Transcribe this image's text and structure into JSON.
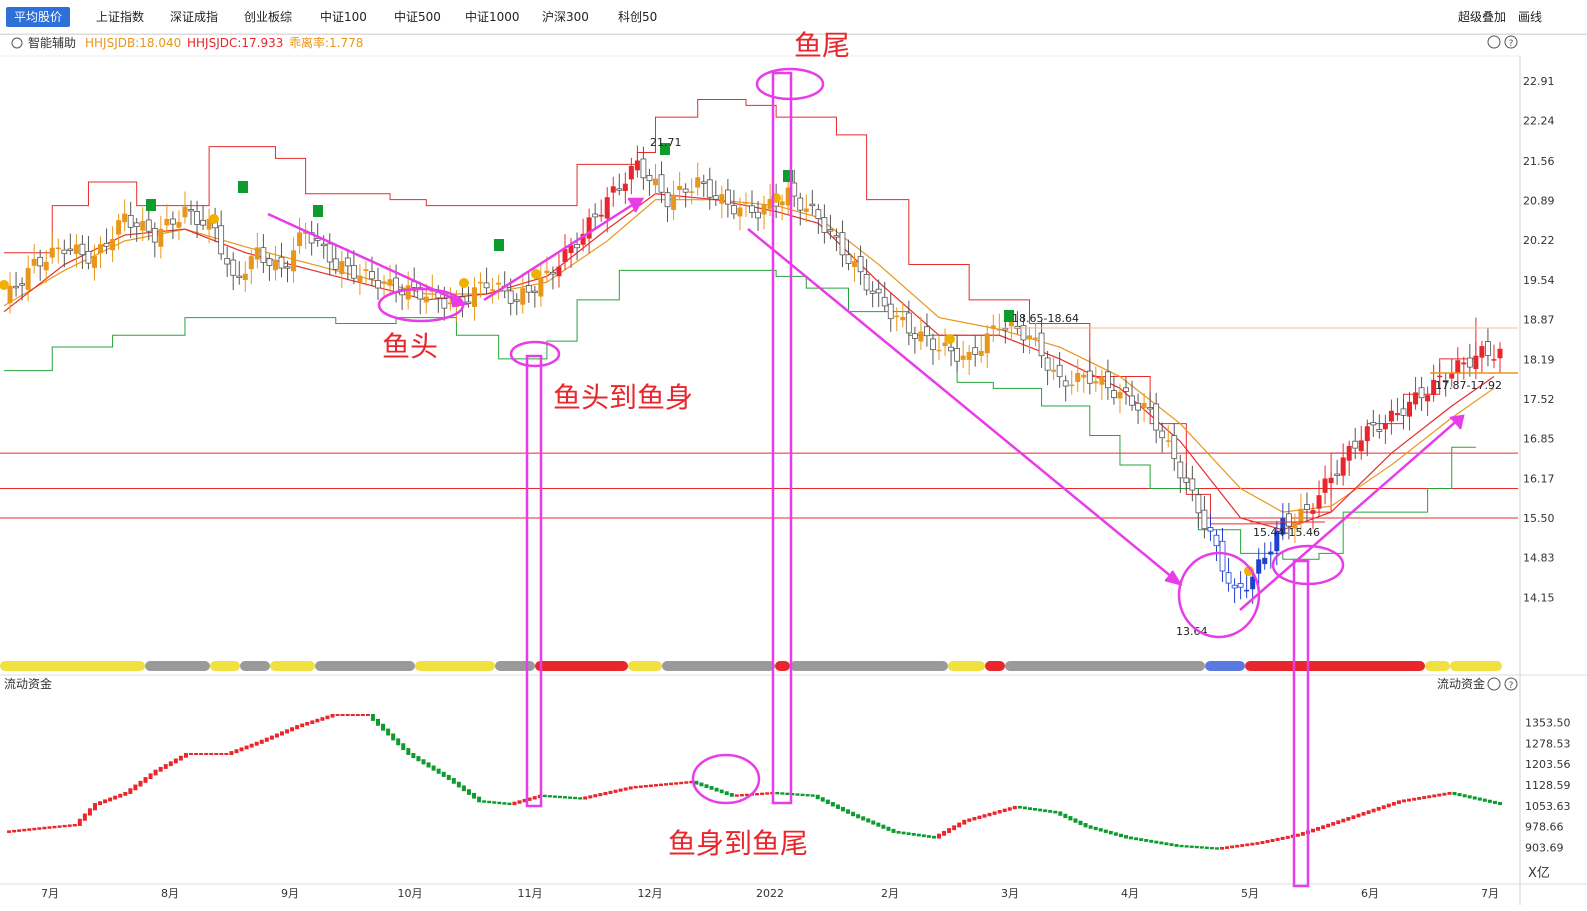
{
  "tabs": [
    "平均股价",
    "上证指数",
    "深证成指",
    "创业板综",
    "中证100",
    "中证500",
    "中证1000",
    "沪深300",
    "科创50"
  ],
  "right_tabs": [
    "超级叠加",
    "画线"
  ],
  "indicator": {
    "name": "智能辅助",
    "db_label": "HHJSJDB:18.040",
    "dc_label": "HHJSJDC:17.933",
    "dev_label": "乖离率:1.778"
  },
  "subchart": {
    "name_left": "流动资金",
    "name_right": "流动资金",
    "unit": "X亿"
  },
  "annotations": {
    "yutou": "鱼头",
    "yutou_yushen": "鱼头到鱼身",
    "yushen_yuwei": "鱼身到鱼尾",
    "yuwei": "鱼尾"
  },
  "price_labels": [
    "21.71",
    "18.65-18.64",
    "15.44-15.46",
    "17.87-17.92",
    "13.64"
  ],
  "colors": {
    "up": "#e8262b",
    "down": "#0e9b2e",
    "orange": "#e8961c",
    "magenta": "#e83ce8",
    "blue": "#2040d0",
    "green_line": "#27a33a",
    "red_line": "#e82b2b",
    "gray": "#9a9a9a",
    "yellow": "#f0e040"
  },
  "chart_data": [
    {
      "type": "candlestick",
      "title": "平均股价",
      "y_axis_ticks": [
        "22.91",
        "22.24",
        "21.56",
        "20.89",
        "20.22",
        "19.54",
        "18.87",
        "18.19",
        "17.52",
        "16.85",
        "16.17",
        "15.50",
        "14.83",
        "14.15"
      ],
      "ylim": [
        13.6,
        23.1
      ],
      "x_axis_ticks": [
        "7月",
        "8月",
        "9月",
        "10月",
        "11月",
        "12月",
        "2022",
        "2月",
        "3月",
        "4月",
        "5月",
        "6月",
        "7月"
      ],
      "horizontal_lines": [
        16.6,
        16.0,
        15.5
      ],
      "price": [
        [
          0,
          19.2
        ],
        [
          5,
          19.8
        ],
        [
          10,
          20.1
        ],
        [
          15,
          19.9
        ],
        [
          20,
          20.6
        ],
        [
          25,
          20.3
        ],
        [
          30,
          20.7
        ],
        [
          35,
          20.4
        ],
        [
          38,
          19.5
        ],
        [
          42,
          20.0
        ],
        [
          46,
          19.7
        ],
        [
          50,
          20.4
        ],
        [
          55,
          19.8
        ],
        [
          60,
          19.6
        ],
        [
          65,
          19.4
        ],
        [
          70,
          19.3
        ],
        [
          75,
          19.1
        ],
        [
          80,
          19.5
        ],
        [
          85,
          19.2
        ],
        [
          90,
          19.6
        ],
        [
          95,
          20.2
        ],
        [
          100,
          20.9
        ],
        [
          105,
          21.5
        ],
        [
          110,
          20.9
        ],
        [
          115,
          21.2
        ],
        [
          120,
          20.8
        ],
        [
          125,
          20.7
        ],
        [
          130,
          21.0
        ],
        [
          135,
          20.6
        ],
        [
          140,
          19.9
        ],
        [
          145,
          19.2
        ],
        [
          150,
          18.7
        ],
        [
          155,
          18.4
        ],
        [
          160,
          18.2
        ],
        [
          165,
          18.8
        ],
        [
          170,
          18.6
        ],
        [
          175,
          17.8
        ],
        [
          180,
          17.9
        ],
        [
          185,
          17.6
        ],
        [
          190,
          17.3
        ],
        [
          195,
          16.3
        ],
        [
          200,
          15.2
        ],
        [
          204,
          14.2
        ],
        [
          207,
          14.5
        ],
        [
          212,
          15.4
        ],
        [
          216,
          15.6
        ],
        [
          220,
          16.2
        ],
        [
          225,
          16.9
        ],
        [
          230,
          17.2
        ],
        [
          235,
          17.6
        ],
        [
          240,
          18.0
        ],
        [
          245,
          18.3
        ],
        [
          248,
          18.3
        ]
      ],
      "upper_band": [
        [
          0,
          20.0
        ],
        [
          8,
          20.8
        ],
        [
          14,
          21.2
        ],
        [
          18,
          21.2
        ],
        [
          22,
          20.8
        ],
        [
          28,
          20.8
        ],
        [
          34,
          21.8
        ],
        [
          45,
          21.6
        ],
        [
          50,
          21.0
        ],
        [
          58,
          21.0
        ],
        [
          64,
          20.9
        ],
        [
          70,
          20.8
        ],
        [
          80,
          20.8
        ],
        [
          95,
          21.5
        ],
        [
          105,
          21.7
        ],
        [
          108,
          22.3
        ],
        [
          115,
          22.6
        ],
        [
          120,
          22.6
        ],
        [
          123,
          22.5
        ],
        [
          128,
          22.3
        ],
        [
          138,
          22.0
        ],
        [
          143,
          20.9
        ],
        [
          150,
          19.8
        ],
        [
          160,
          19.2
        ],
        [
          170,
          18.8
        ],
        [
          180,
          17.9
        ],
        [
          190,
          17.1
        ],
        [
          196,
          15.9
        ],
        [
          200,
          15.4
        ],
        [
          208,
          15.4
        ],
        [
          215,
          15.6
        ],
        [
          220,
          16.6
        ],
        [
          226,
          17.1
        ],
        [
          232,
          17.6
        ],
        [
          238,
          18.2
        ],
        [
          244,
          18.9
        ]
      ],
      "lower_band": [
        [
          0,
          18.0
        ],
        [
          8,
          18.4
        ],
        [
          18,
          18.6
        ],
        [
          30,
          18.9
        ],
        [
          45,
          18.9
        ],
        [
          55,
          18.8
        ],
        [
          65,
          18.9
        ],
        [
          75,
          18.6
        ],
        [
          82,
          18.2
        ],
        [
          90,
          18.5
        ],
        [
          95,
          19.2
        ],
        [
          102,
          19.7
        ],
        [
          108,
          19.7
        ],
        [
          120,
          19.7
        ],
        [
          128,
          19.6
        ],
        [
          133,
          19.4
        ],
        [
          140,
          19.0
        ],
        [
          150,
          18.6
        ],
        [
          158,
          17.8
        ],
        [
          164,
          17.7
        ],
        [
          172,
          17.4
        ],
        [
          180,
          16.9
        ],
        [
          185,
          16.4
        ],
        [
          190,
          16.0
        ],
        [
          198,
          15.3
        ],
        [
          205,
          14.9
        ],
        [
          212,
          14.8
        ],
        [
          218,
          14.9
        ],
        [
          222,
          15.6
        ],
        [
          230,
          15.6
        ],
        [
          236,
          16.0
        ],
        [
          240,
          16.7
        ],
        [
          244,
          16.7
        ]
      ],
      "ma_fast": [
        [
          0,
          19.0
        ],
        [
          10,
          19.8
        ],
        [
          20,
          20.3
        ],
        [
          30,
          20.4
        ],
        [
          40,
          20.0
        ],
        [
          55,
          19.6
        ],
        [
          70,
          19.2
        ],
        [
          80,
          19.3
        ],
        [
          90,
          19.6
        ],
        [
          100,
          20.4
        ],
        [
          108,
          21.0
        ],
        [
          118,
          20.9
        ],
        [
          128,
          20.7
        ],
        [
          135,
          20.5
        ],
        [
          145,
          19.5
        ],
        [
          155,
          18.6
        ],
        [
          165,
          18.6
        ],
        [
          175,
          18.2
        ],
        [
          185,
          17.7
        ],
        [
          195,
          16.8
        ],
        [
          205,
          15.5
        ],
        [
          212,
          15.3
        ],
        [
          220,
          15.6
        ],
        [
          230,
          16.6
        ],
        [
          240,
          17.4
        ],
        [
          247,
          17.9
        ]
      ],
      "ma_slow": [
        [
          0,
          19.1
        ],
        [
          10,
          19.7
        ],
        [
          20,
          20.2
        ],
        [
          30,
          20.4
        ],
        [
          40,
          20.1
        ],
        [
          55,
          19.7
        ],
        [
          70,
          19.3
        ],
        [
          80,
          19.3
        ],
        [
          90,
          19.5
        ],
        [
          100,
          20.2
        ],
        [
          108,
          20.9
        ],
        [
          118,
          20.9
        ],
        [
          128,
          20.8
        ],
        [
          135,
          20.6
        ],
        [
          145,
          19.8
        ],
        [
          155,
          18.9
        ],
        [
          165,
          18.7
        ],
        [
          175,
          18.4
        ],
        [
          185,
          17.9
        ],
        [
          195,
          17.1
        ],
        [
          205,
          16.0
        ],
        [
          212,
          15.6
        ],
        [
          220,
          15.7
        ],
        [
          230,
          16.4
        ],
        [
          240,
          17.2
        ],
        [
          247,
          17.7
        ]
      ]
    },
    {
      "type": "line",
      "title": "流动资金",
      "y_axis_ticks": [
        "1353.50",
        "1278.53",
        "1203.56",
        "1128.59",
        "1053.63",
        "978.66",
        "903.69"
      ],
      "ylim": [
        870,
        1380
      ],
      "values": [
        [
          0,
          960
        ],
        [
          8,
          975
        ],
        [
          14,
          985
        ],
        [
          18,
          1060
        ],
        [
          24,
          1100
        ],
        [
          30,
          1180
        ],
        [
          36,
          1240
        ],
        [
          44,
          1240
        ],
        [
          50,
          1280
        ],
        [
          58,
          1340
        ],
        [
          65,
          1380
        ],
        [
          72,
          1380
        ],
        [
          80,
          1240
        ],
        [
          88,
          1150
        ],
        [
          94,
          1070
        ],
        [
          100,
          1060
        ],
        [
          106,
          1090
        ],
        [
          114,
          1080
        ],
        [
          124,
          1120
        ],
        [
          136,
          1140
        ],
        [
          144,
          1090
        ],
        [
          152,
          1100
        ],
        [
          160,
          1090
        ],
        [
          168,
          1020
        ],
        [
          176,
          960
        ],
        [
          184,
          940
        ],
        [
          190,
          1000
        ],
        [
          200,
          1050
        ],
        [
          208,
          1030
        ],
        [
          214,
          980
        ],
        [
          222,
          940
        ],
        [
          232,
          910
        ],
        [
          240,
          900
        ],
        [
          248,
          920
        ],
        [
          256,
          950
        ],
        [
          266,
          1010
        ],
        [
          276,
          1070
        ],
        [
          286,
          1100
        ],
        [
          296,
          1060
        ]
      ]
    }
  ]
}
